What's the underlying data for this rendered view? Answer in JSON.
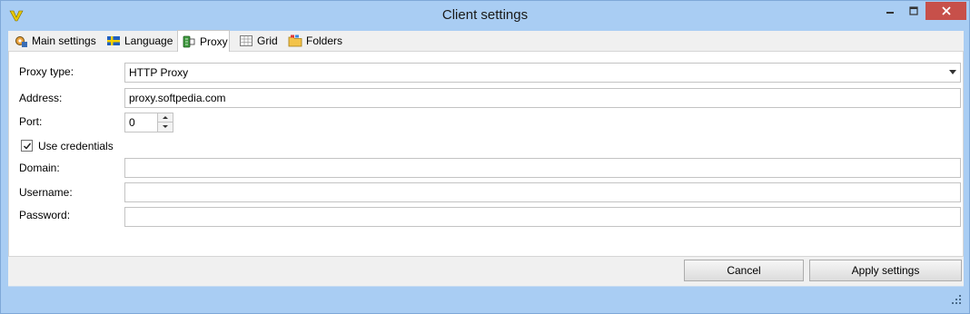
{
  "window": {
    "title": "Client settings",
    "controls": {
      "minimize": "minimize",
      "maximize": "maximize",
      "close": "close"
    }
  },
  "tabs": [
    {
      "label": "Main settings",
      "icon": "main-settings-icon"
    },
    {
      "label": "Language",
      "icon": "flag-icon"
    },
    {
      "label": "Proxy",
      "icon": "proxy-icon",
      "active": true
    },
    {
      "label": "Grid",
      "icon": "grid-icon"
    },
    {
      "label": "Folders",
      "icon": "folders-icon"
    }
  ],
  "form": {
    "proxy_type_label": "Proxy type:",
    "proxy_type_value": "HTTP Proxy",
    "address_label": "Address:",
    "address_value": "proxy.softpedia.com",
    "port_label": "Port:",
    "port_value": "0",
    "use_credentials_label": "Use credentials",
    "use_credentials_checked": true,
    "domain_label": "Domain:",
    "domain_value": "",
    "username_label": "Username:",
    "username_value": "",
    "password_label": "Password:",
    "password_value": ""
  },
  "buttons": {
    "cancel": "Cancel",
    "apply": "Apply settings"
  },
  "colors": {
    "frame": "#a9cdf3",
    "close_button": "#c7504a"
  }
}
